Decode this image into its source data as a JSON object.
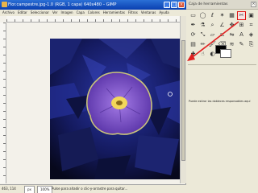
{
  "window": {
    "title": "Flor.campestre.jpg-1.0 (RGB, 1 capa) 640x480 – GIMP",
    "menu": [
      "Archivo",
      "Editar",
      "Seleccionar",
      "Ver",
      "Imagen",
      "Capa",
      "Colores",
      "Herramientas",
      "Filtros",
      "Ventanas",
      "Ayuda"
    ]
  },
  "statusbar": {
    "coords": "463, 114",
    "unit": "px",
    "zoom": "100%",
    "message": "Pulse para añadir o clic-y-arrastre para quitar..."
  },
  "toolbox": {
    "title": "Caja de herramientas",
    "close": "×",
    "tools": [
      {
        "name": "rect-select-icon",
        "glyph": "▭"
      },
      {
        "name": "ellipse-select-icon",
        "glyph": "◯"
      },
      {
        "name": "free-select-icon",
        "glyph": "ℓ"
      },
      {
        "name": "fuzzy-select-icon",
        "glyph": "✶"
      },
      {
        "name": "select-by-color-icon",
        "glyph": "▦"
      },
      {
        "name": "scissors-icon",
        "glyph": "✂"
      },
      {
        "name": "foreground-select-icon",
        "glyph": "▣"
      },
      {
        "name": "paths-icon",
        "glyph": "✒"
      },
      {
        "name": "color-picker-icon",
        "glyph": "⚗"
      },
      {
        "name": "zoom-icon",
        "glyph": "⌕"
      },
      {
        "name": "measure-icon",
        "glyph": "∠"
      },
      {
        "name": "move-icon",
        "glyph": "✥"
      },
      {
        "name": "align-icon",
        "glyph": "⊞"
      },
      {
        "name": "crop-icon",
        "glyph": "⌗"
      },
      {
        "name": "rotate-icon",
        "glyph": "⟳"
      },
      {
        "name": "scale-icon",
        "glyph": "⤡"
      },
      {
        "name": "shear-icon",
        "glyph": "▱"
      },
      {
        "name": "perspective-icon",
        "glyph": "⏢"
      },
      {
        "name": "flip-icon",
        "glyph": "⇋"
      },
      {
        "name": "text-icon",
        "glyph": "A"
      },
      {
        "name": "bucket-fill-icon",
        "glyph": "◈"
      },
      {
        "name": "blend-icon",
        "glyph": "▤"
      },
      {
        "name": "pencil-icon",
        "glyph": "✏"
      },
      {
        "name": "paintbrush-icon",
        "glyph": "🖌"
      },
      {
        "name": "eraser-icon",
        "glyph": "⌫"
      },
      {
        "name": "airbrush-icon",
        "glyph": "≋"
      },
      {
        "name": "ink-icon",
        "glyph": "✎"
      },
      {
        "name": "clone-icon",
        "glyph": "⎘"
      },
      {
        "name": "heal-icon",
        "glyph": "✚"
      },
      {
        "name": "smudge-icon",
        "glyph": "☝"
      },
      {
        "name": "dodge-icon",
        "glyph": "◐"
      }
    ],
    "selected_tool_index": 5,
    "options_text": "Puede estirar las dobleces responsables aquí"
  },
  "colors": {
    "accent_highlight": "#dd1111",
    "annotation_arrow": "#e02020",
    "flower": "#7b4fc4",
    "flower_center": "#f2d75a",
    "background_foliage": "#1f2a7a"
  }
}
